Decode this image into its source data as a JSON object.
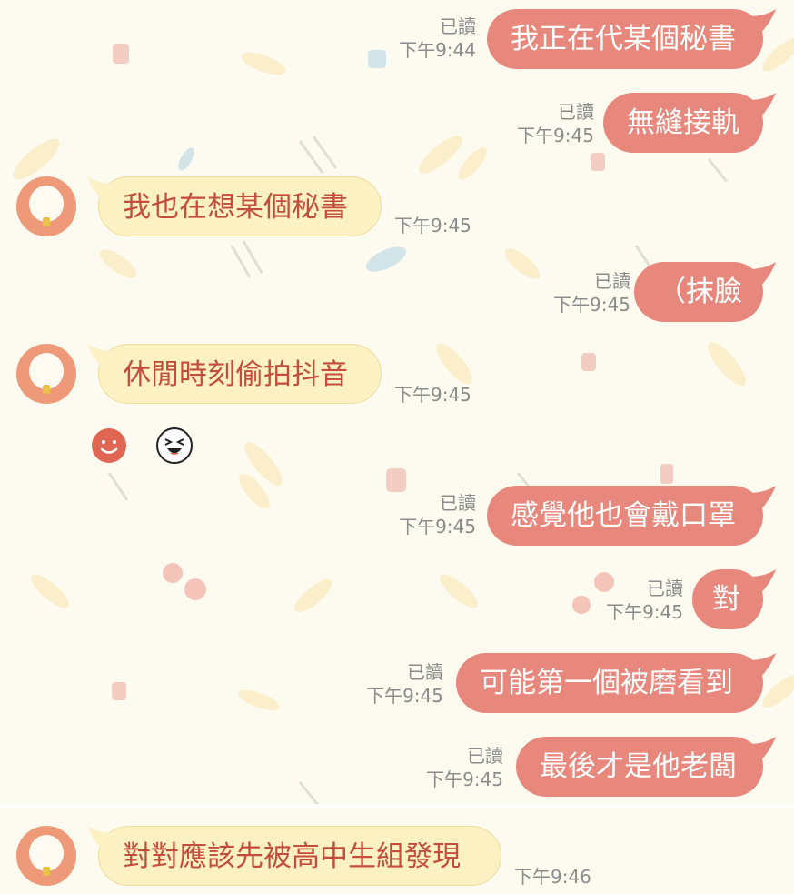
{
  "colors": {
    "background": "#fdfaf0",
    "outgoing_bubble": "#e8877c",
    "outgoing_text": "#ffffff",
    "incoming_bubble": "#fcf1c2",
    "incoming_text": "#c44d3c",
    "meta_text": "#8c8c8c",
    "avatar": "#ee9a79"
  },
  "messages": [
    {
      "direction": "out",
      "text": "我正在代某個秘書",
      "read": "已讀",
      "time": "下午9:44"
    },
    {
      "direction": "out",
      "text": "無縫接軌",
      "read": "已讀",
      "time": "下午9:45"
    },
    {
      "direction": "in",
      "text": "我也在想某個秘書",
      "time": "下午9:45"
    },
    {
      "direction": "out",
      "text": "（抹臉",
      "read": "已讀",
      "time": "下午9:45"
    },
    {
      "direction": "in",
      "text": "休閒時刻偷拍抖音",
      "time": "下午9:45"
    },
    {
      "direction": "out",
      "text": "感覺他也會戴口罩",
      "read": "已讀",
      "time": "下午9:45"
    },
    {
      "direction": "out",
      "text": "對",
      "read": "已讀",
      "time": "下午9:45"
    },
    {
      "direction": "out",
      "text": "可能第一個被磨看到",
      "read": "已讀",
      "time": "下午9:45"
    },
    {
      "direction": "out",
      "text": "最後才是他老闆",
      "read": "已讀",
      "time": "下午9:45"
    },
    {
      "direction": "in",
      "text": "對對應該先被高中生組發現",
      "time": "下午9:46"
    }
  ],
  "reactions": [
    {
      "icon": "smile-face-icon"
    },
    {
      "icon": "laughing-face-icon"
    }
  ]
}
